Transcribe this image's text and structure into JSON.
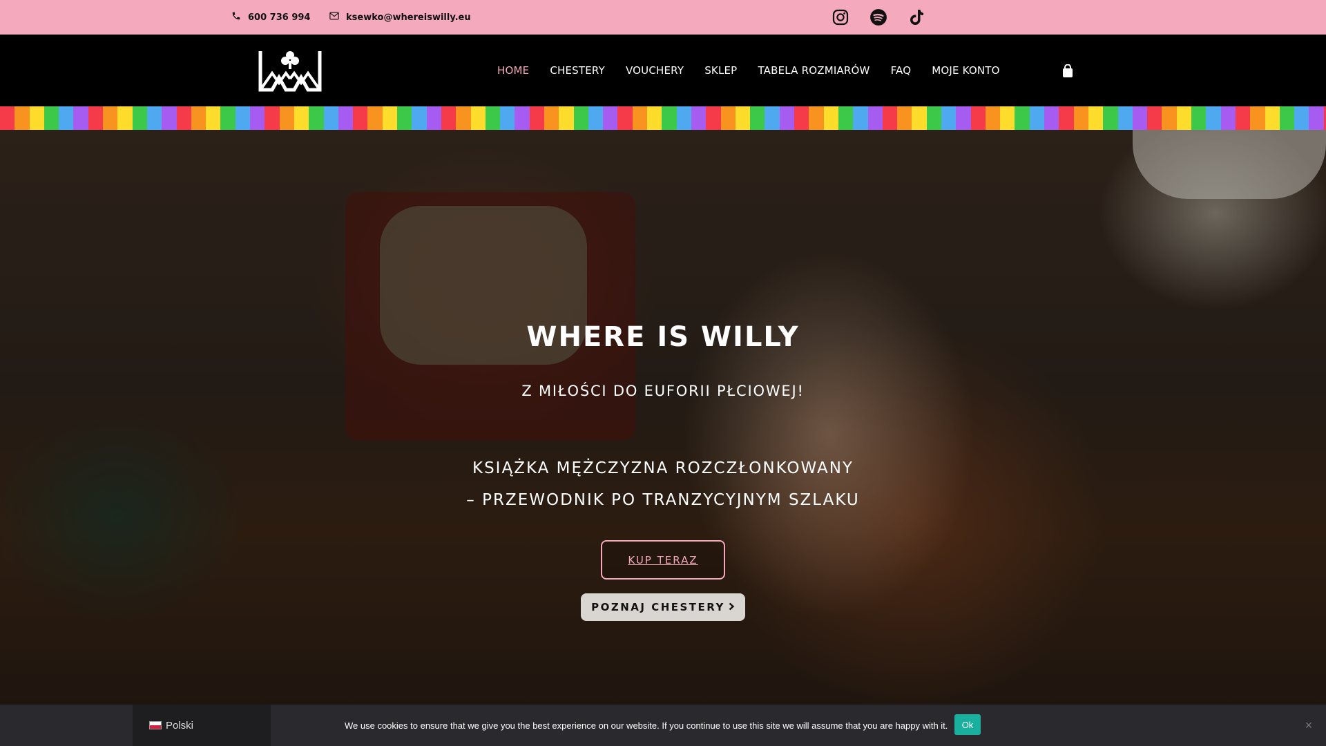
{
  "topbar": {
    "phone": "600 736 994",
    "email": "ksewko@whereiswilly.eu",
    "social_icons": [
      "instagram-icon",
      "spotify-icon",
      "tiktok-icon"
    ]
  },
  "nav": {
    "items": [
      {
        "label": "HOME",
        "active": true
      },
      {
        "label": "CHESTERY"
      },
      {
        "label": "VOUCHERY"
      },
      {
        "label": "SKLEP"
      },
      {
        "label": "TABELA ROZMIARÓW"
      },
      {
        "label": "FAQ"
      },
      {
        "label": "MOJE KONTO"
      }
    ],
    "cart_icon": "shopping-bag-icon"
  },
  "hero": {
    "title": "WHERE IS WILLY",
    "subtitle": "Z MIŁOŚCI DO EUFORII PŁCIOWEJ!",
    "book_line1": "KSIĄŻKA MĘŻCZYZNA ROZCZŁONKOWANY",
    "book_line2": "– PRZEWODNIK PO TRANZYCYJNYM SZLAKU",
    "buy_button": "KUP TERAZ",
    "chesters_button": "POZNAJ CHESTERY",
    "chesters_button_icon": "chevron-right-icon"
  },
  "cookie": {
    "language": "Polski",
    "text": "We use cookies to ensure that we give you the best experience on our website. If you continue to use this site we will assume that you are happy with it.",
    "ok_label": "Ok",
    "close_symbol": "×"
  },
  "colors": {
    "accent_pink": "#f4a9bd",
    "header_bg": "#000000",
    "cookie_ok": "#1ab0a0",
    "rainbow": [
      "#f53a4a",
      "#f7931e",
      "#fddc2c",
      "#3cc94a",
      "#4fa9f0",
      "#a65cf0"
    ]
  }
}
